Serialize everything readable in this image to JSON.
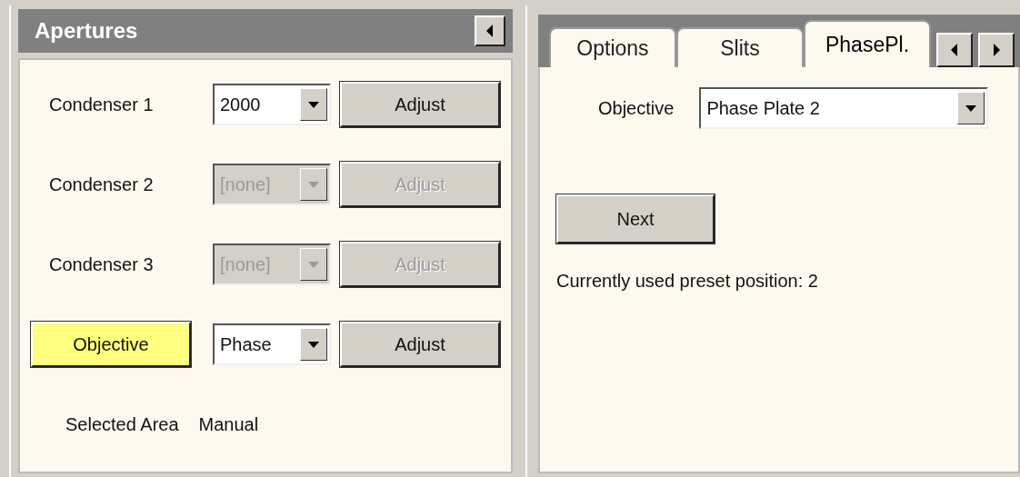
{
  "apertures": {
    "title": "Apertures",
    "rows": [
      {
        "kind": "label",
        "label": "Condenser 1",
        "value": "2000",
        "disabled": false,
        "button": "Adjust"
      },
      {
        "kind": "label",
        "label": "Condenser 2",
        "value": "[none]",
        "disabled": true,
        "button": "Adjust"
      },
      {
        "kind": "label",
        "label": "Condenser 3",
        "value": "[none]",
        "disabled": true,
        "button": "Adjust"
      },
      {
        "kind": "toggle",
        "label": "Objective",
        "highlighted": true,
        "value": "Phase",
        "disabled": false,
        "button": "Adjust"
      }
    ],
    "selected_area": {
      "label": "Selected Area",
      "value": "Manual"
    }
  },
  "settings": {
    "tabs": [
      {
        "label": "Options",
        "selected": false
      },
      {
        "label": "Slits",
        "selected": false
      },
      {
        "label": "PhasePl.",
        "selected": true
      }
    ],
    "objective": {
      "label": "Objective",
      "value": "Phase Plate 2"
    },
    "next_button": "Next",
    "status": "Currently used preset position: 2"
  }
}
